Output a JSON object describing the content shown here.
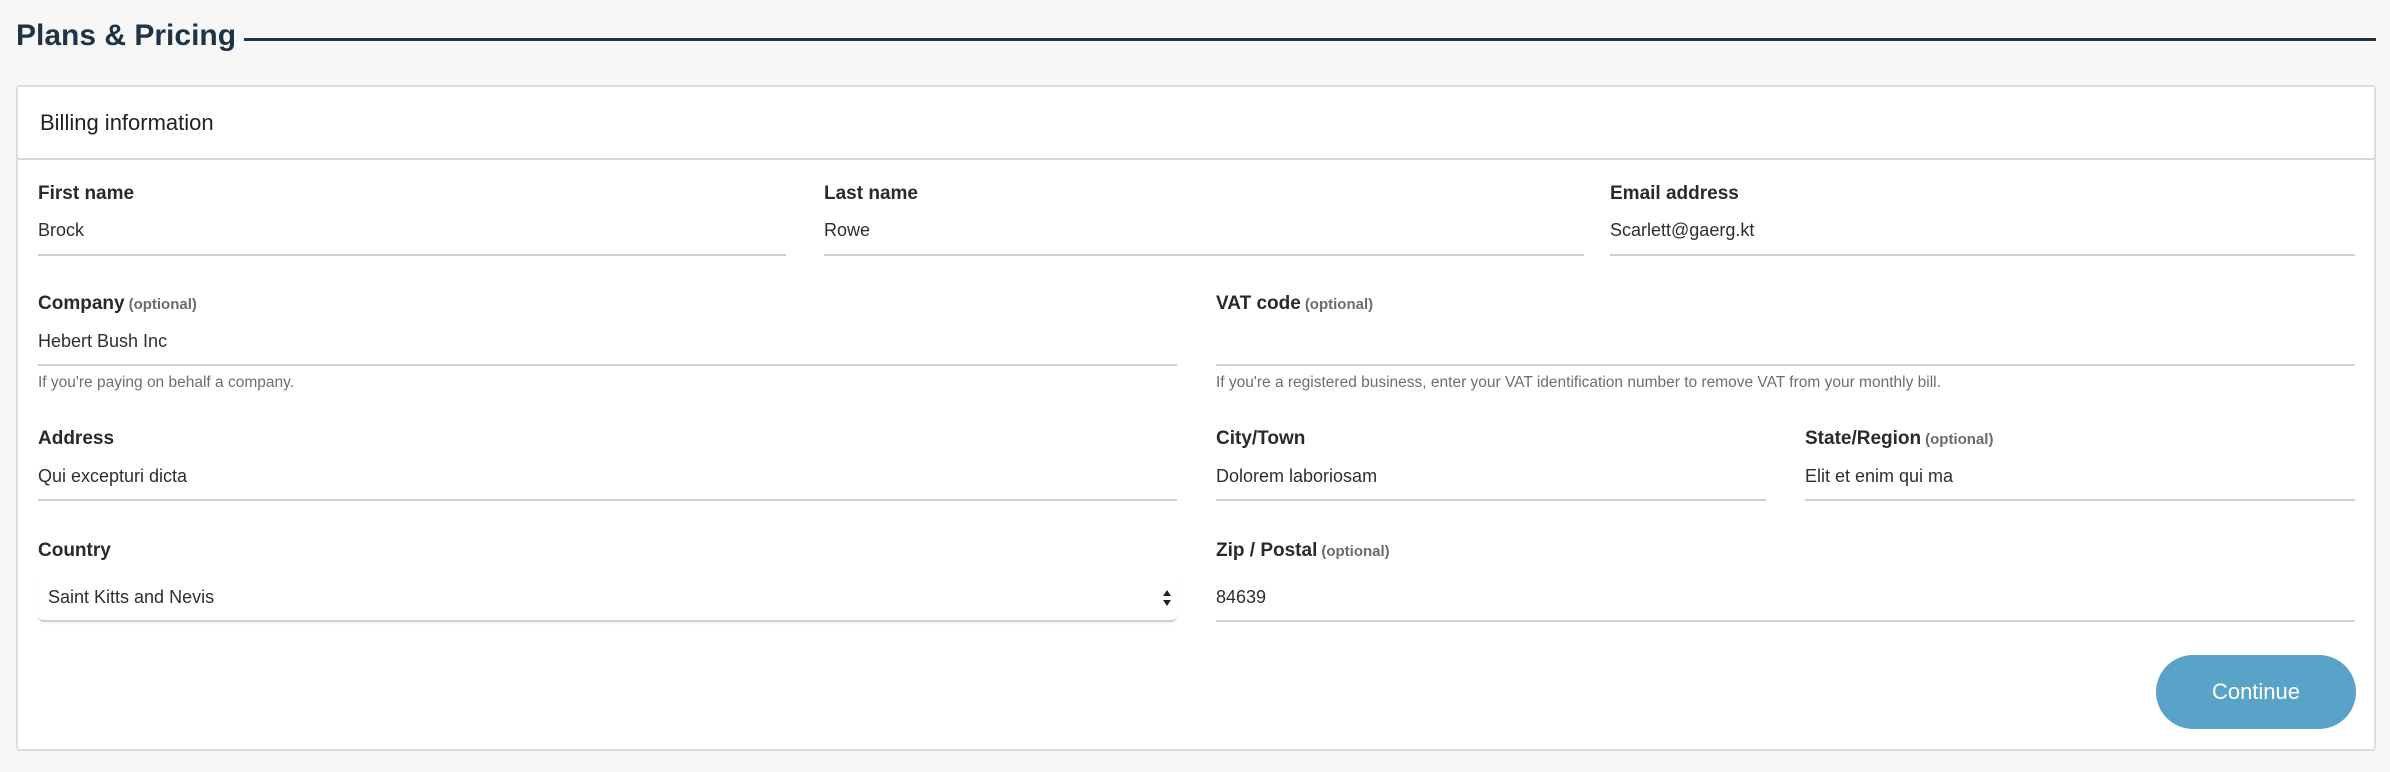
{
  "header": {
    "title": "Plans & Pricing"
  },
  "card": {
    "title": "Billing information"
  },
  "form": {
    "first_name": {
      "label": "First name",
      "value": "Brock"
    },
    "last_name": {
      "label": "Last name",
      "value": "Rowe"
    },
    "email": {
      "label": "Email address",
      "value": "Scarlett@gaerg.kt"
    },
    "company": {
      "label": "Company",
      "optional": "(optional)",
      "value": "Hebert Bush Inc",
      "helper": "If you're paying on behalf a company."
    },
    "vat": {
      "label": "VAT code",
      "optional": "(optional)",
      "value": "",
      "helper": "If you're a registered business, enter your VAT identification number to remove VAT from your monthly bill."
    },
    "address": {
      "label": "Address",
      "value": "Qui excepturi dicta"
    },
    "city": {
      "label": "City/Town",
      "value": "Dolorem laboriosam"
    },
    "state": {
      "label": "State/Region",
      "optional": "(optional)",
      "value": "Elit et enim qui ma"
    },
    "country": {
      "label": "Country",
      "value": "Saint Kitts and Nevis"
    },
    "zip": {
      "label": "Zip / Postal",
      "optional": "(optional)",
      "value": "84639"
    }
  },
  "actions": {
    "continue_label": "Continue"
  },
  "colors": {
    "title": "#1f3347",
    "button": "#5aa3c8",
    "rule": "#cfcfcf"
  }
}
